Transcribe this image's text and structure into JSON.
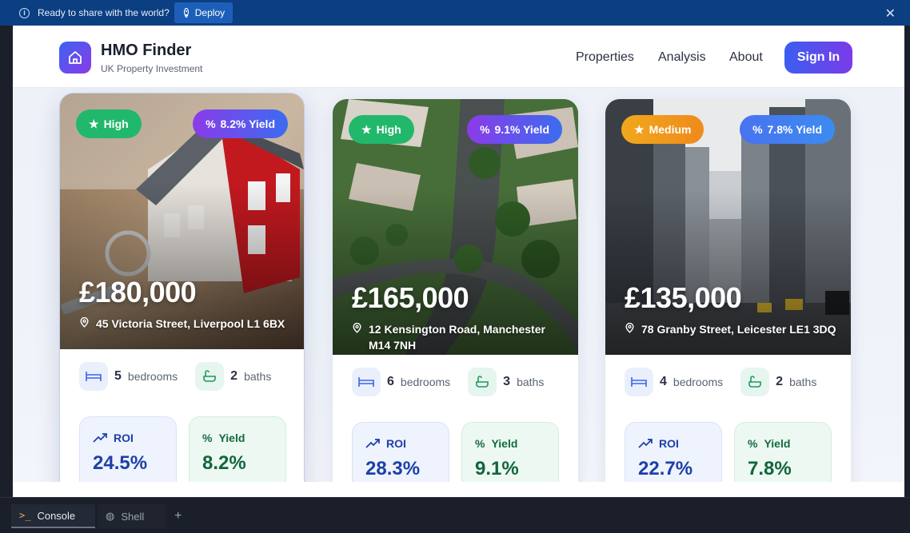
{
  "banner": {
    "message": "Ready to share with the world?",
    "deploy_label": "Deploy",
    "info_icon": "info-icon",
    "close_icon": "close-icon"
  },
  "header": {
    "brand_title": "HMO Finder",
    "brand_subtitle": "UK Property Investment",
    "nav": [
      "Properties",
      "Analysis",
      "About"
    ],
    "sign_in_label": "Sign In",
    "logo_icon": "home-icon",
    "accent_gradient": [
      "#3b63f0",
      "#8b3be8"
    ]
  },
  "properties": [
    {
      "rating": "High",
      "rating_color": "#22b86b",
      "yield_badge": "8.2% Yield",
      "price": "£180,000",
      "address": "45 Victoria Street, Liverpool L1 6BX",
      "bedrooms": "5",
      "bedrooms_label": "bedrooms",
      "baths": "2",
      "baths_label": "baths",
      "roi_label": "ROI",
      "roi": "24.5%",
      "yield_label": "Yield",
      "yield": "8.2%",
      "image": "house-model-with-keys"
    },
    {
      "rating": "High",
      "rating_color": "#22b86b",
      "yield_badge": "9.1% Yield",
      "price": "£165,000",
      "address": "12 Kensington Road, Manchester M14 7NH",
      "bedrooms": "6",
      "bedrooms_label": "bedrooms",
      "baths": "3",
      "baths_label": "baths",
      "roi_label": "ROI",
      "roi": "28.3%",
      "yield_label": "Yield",
      "yield": "9.1%",
      "image": "aerial-suburb"
    },
    {
      "rating": "Medium",
      "rating_color": "#f0a81c",
      "yield_badge": "7.8% Yield",
      "price": "£135,000",
      "address": "78 Granby Street, Leicester LE1 3DQ",
      "bedrooms": "4",
      "bedrooms_label": "bedrooms",
      "baths": "2",
      "baths_label": "baths",
      "roi_label": "ROI",
      "roi": "22.7%",
      "yield_label": "Yield",
      "yield": "7.8%",
      "image": "city-street"
    }
  ],
  "bottom_tabs": {
    "console": "Console",
    "shell": "Shell",
    "add": "+"
  }
}
